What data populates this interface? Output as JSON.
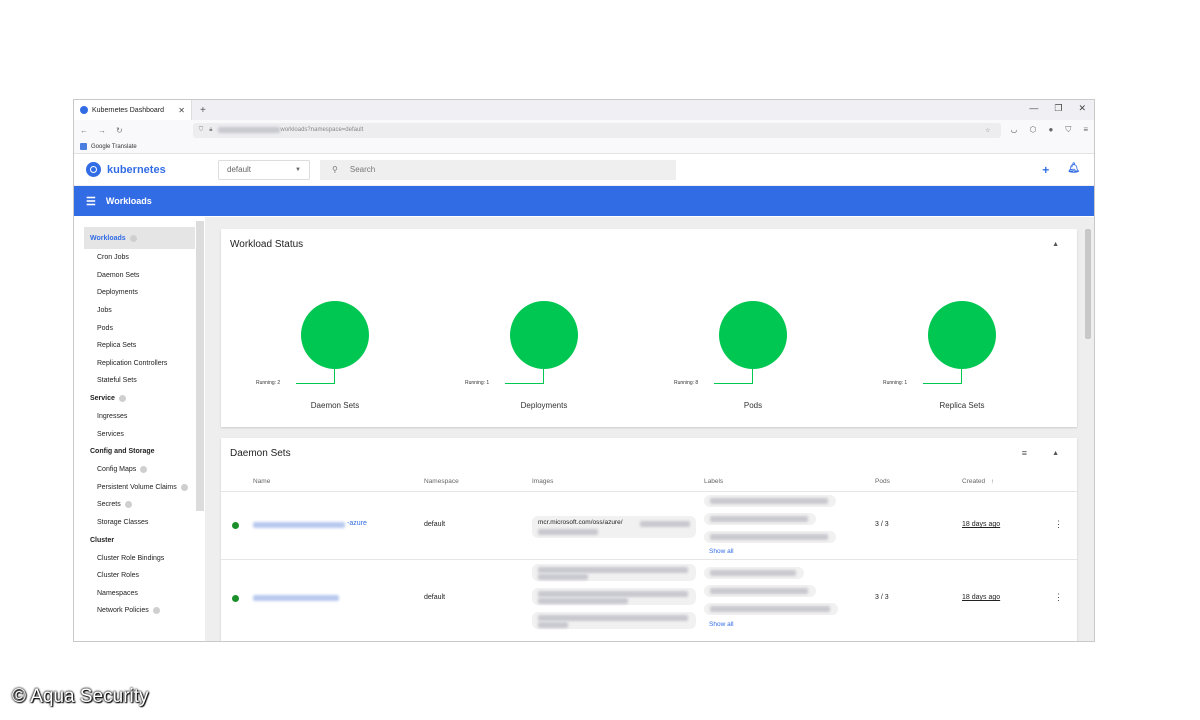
{
  "browser": {
    "tab_title": "Kubernetes Dashboard",
    "url_suffix": "workloads?namespace=default",
    "bookmark": "Google Translate"
  },
  "header": {
    "brand": "kubernetes",
    "namespace": "default",
    "search_placeholder": "Search"
  },
  "toolbar": {
    "title": "Workloads"
  },
  "sidebar": {
    "sections": [
      {
        "label": "Workloads",
        "items": [
          "Cron Jobs",
          "Daemon Sets",
          "Deployments",
          "Jobs",
          "Pods",
          "Replica Sets",
          "Replication Controllers",
          "Stateful Sets"
        ]
      },
      {
        "label": "Service",
        "items": [
          "Ingresses",
          "Services"
        ]
      },
      {
        "label": "Config and Storage",
        "items": [
          "Config Maps",
          "Persistent Volume Claims",
          "Secrets",
          "Storage Classes"
        ]
      },
      {
        "label": "Cluster",
        "items": [
          "Cluster Role Bindings",
          "Cluster Roles",
          "Namespaces",
          "Network Policies"
        ]
      }
    ]
  },
  "workload_status": {
    "title": "Workload Status",
    "items": [
      {
        "running_label": "Running: 2",
        "name": "Daemon Sets"
      },
      {
        "running_label": "Running: 1",
        "name": "Deployments"
      },
      {
        "running_label": "Running: 8",
        "name": "Pods"
      },
      {
        "running_label": "Running: 1",
        "name": "Replica Sets"
      }
    ],
    "colors": {
      "running": "#00c752"
    }
  },
  "daemon_sets": {
    "title": "Daemon Sets",
    "columns": [
      "Name",
      "Namespace",
      "Images",
      "Labels",
      "Pods",
      "Created"
    ],
    "rows": [
      {
        "name_suffix": "-azure",
        "namespace": "default",
        "image": "mcr.microsoft.com/oss/azure/",
        "show_all": "Show all",
        "pods": "3 / 3",
        "created": "18 days ago"
      },
      {
        "name_suffix": "",
        "namespace": "default",
        "image": "",
        "show_all": "Show all",
        "pods": "3 / 3",
        "created": "18 days ago"
      }
    ]
  },
  "watermark": "© Aqua Security",
  "theme": {
    "brand_blue": "#326ce5"
  }
}
